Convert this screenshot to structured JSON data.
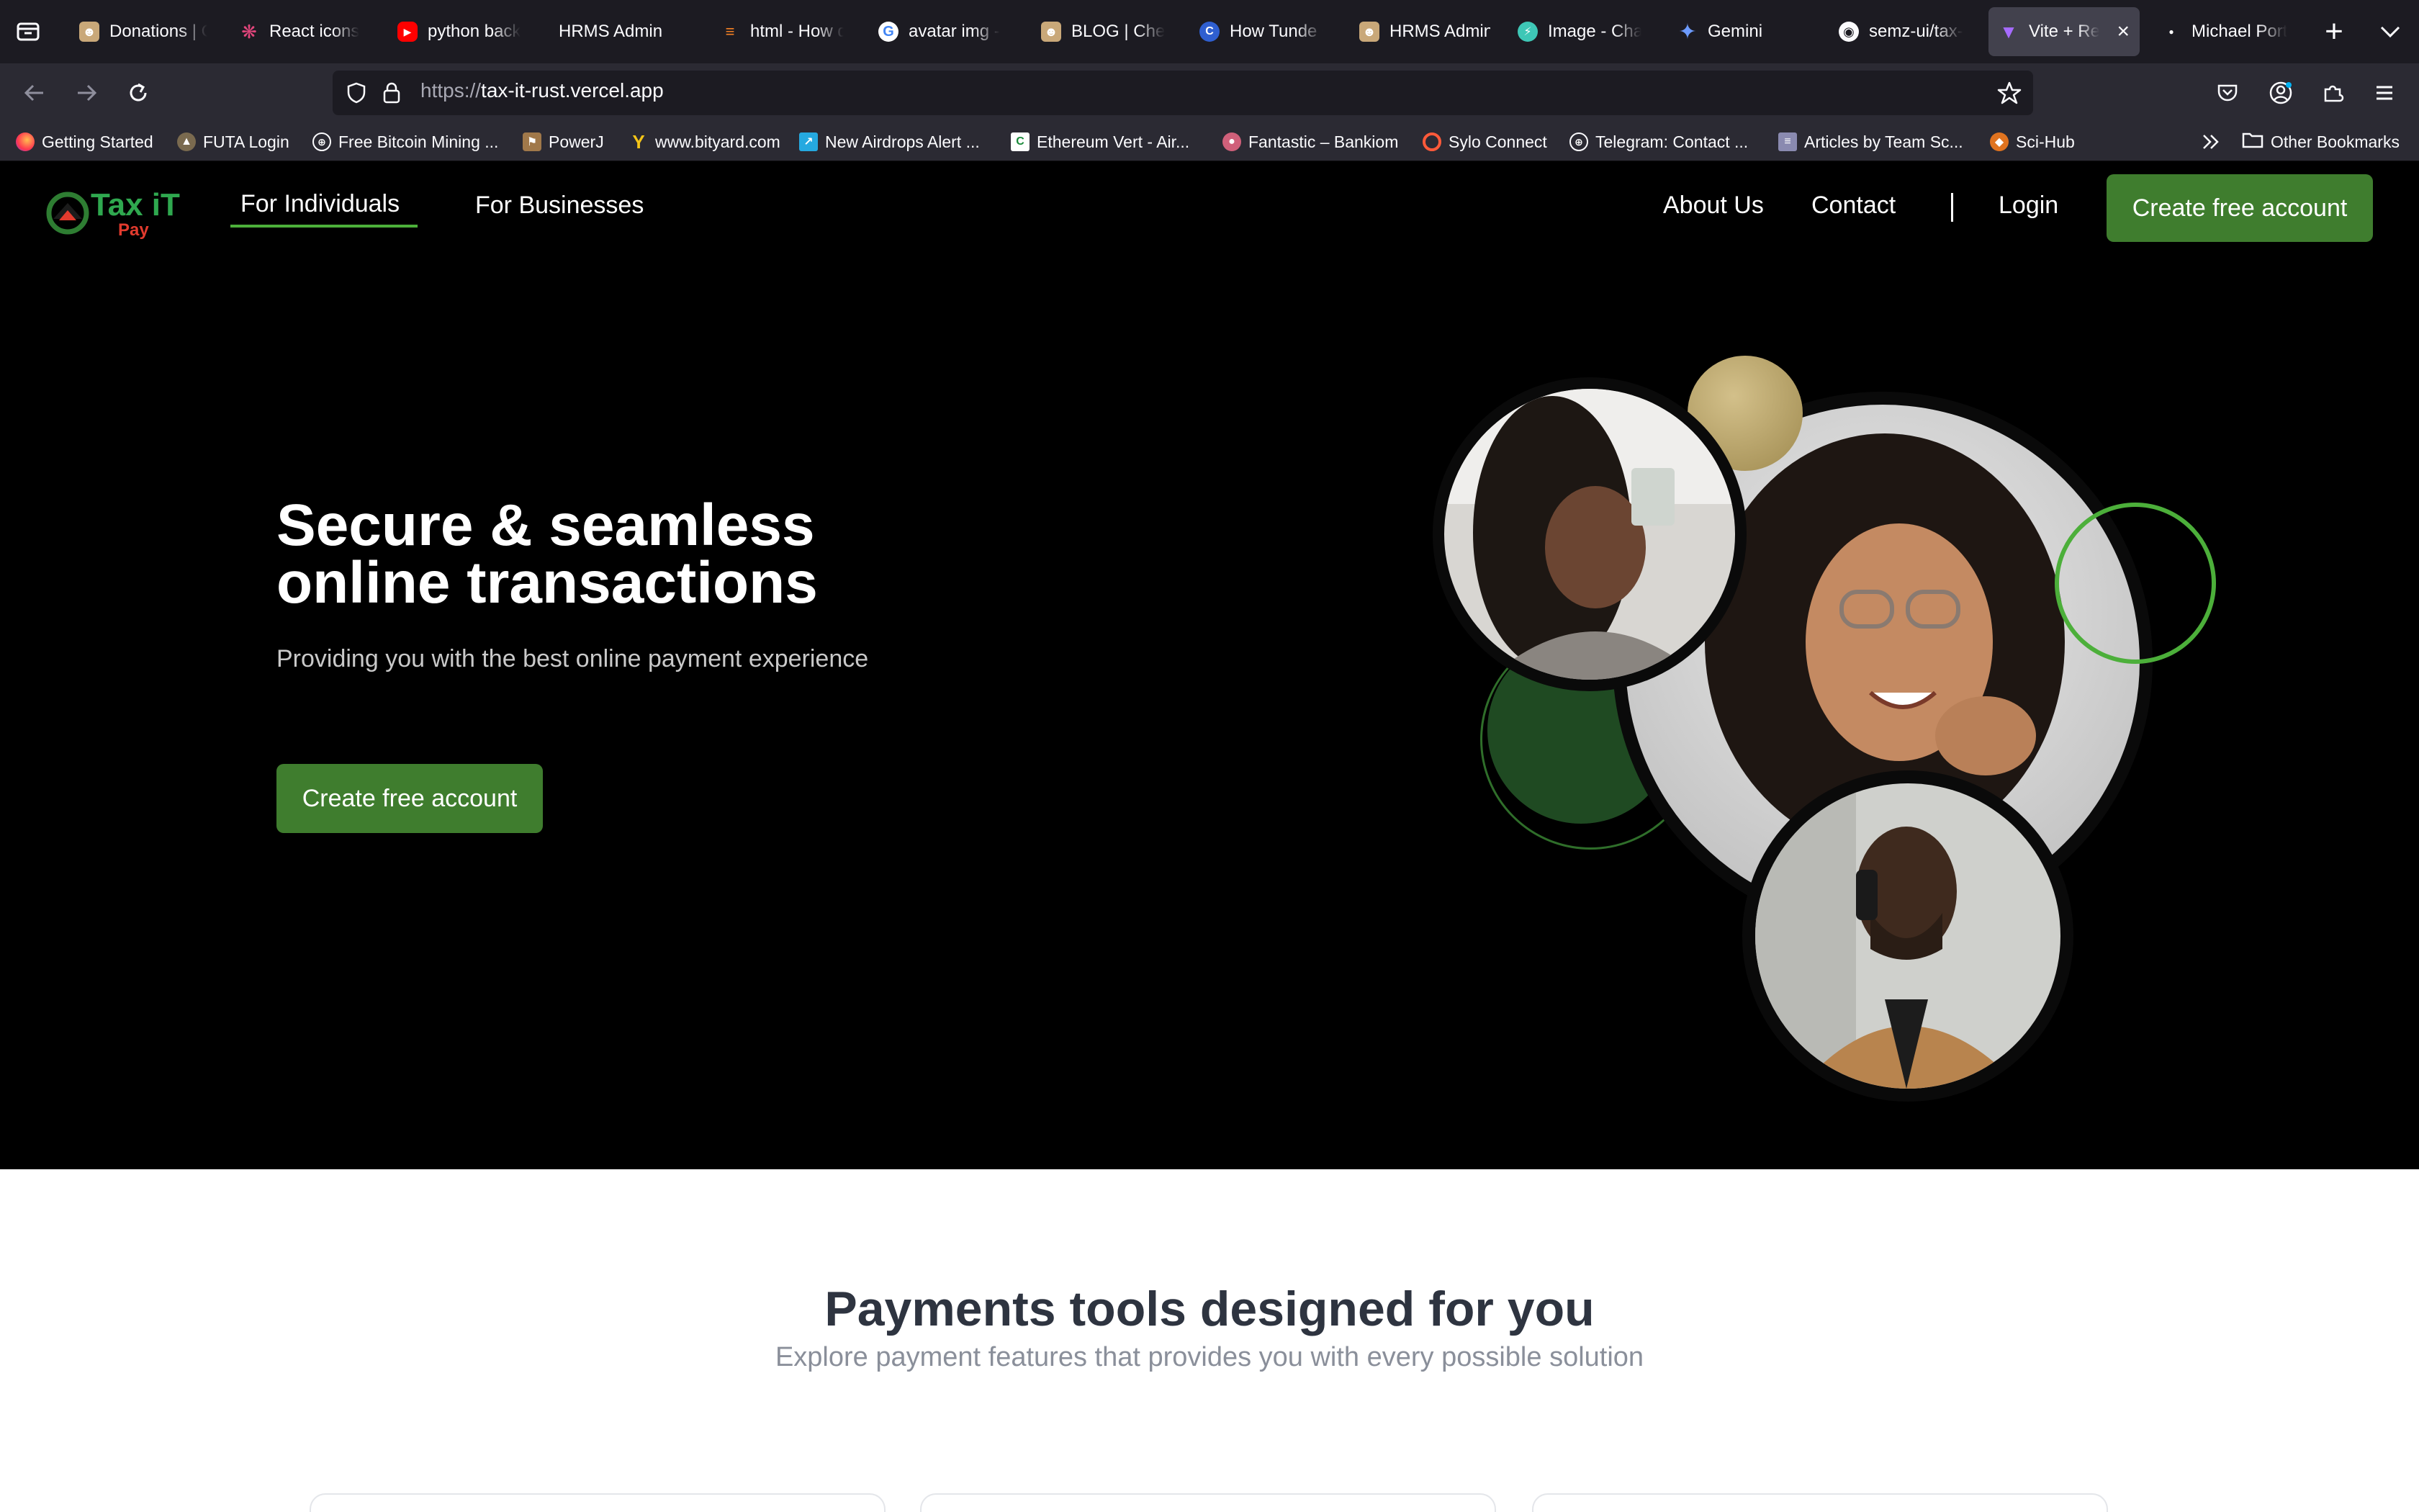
{
  "browser": {
    "tabs": [
      {
        "title": "Donations | C",
        "icon": "portrait-icon"
      },
      {
        "title": "React icons",
        "icon": "react-icon"
      },
      {
        "title": "python back",
        "icon": "youtube-icon"
      },
      {
        "title": "HRMS Admin",
        "icon": ""
      },
      {
        "title": "html - How d",
        "icon": "stackoverflow-icon"
      },
      {
        "title": "avatar img -",
        "icon": "google-icon"
      },
      {
        "title": "BLOG | Ches",
        "icon": "portrait-icon"
      },
      {
        "title": "How Tunde C",
        "icon": "blue-logo-icon"
      },
      {
        "title": "HRMS Admin",
        "icon": "portrait-icon"
      },
      {
        "title": "Image - Cha",
        "icon": "chat-bolt-icon"
      },
      {
        "title": "Gemini",
        "icon": "gemini-icon"
      },
      {
        "title": "semz-ui/tax-",
        "icon": "github-icon"
      },
      {
        "title": "Vite + Rea",
        "icon": "vite-icon"
      },
      {
        "title": "Michael Port",
        "icon": "dot-icon"
      }
    ],
    "url": {
      "scheme": "https://",
      "host": "tax-it-rust.vercel.app"
    },
    "bookmarks": [
      {
        "label": "Getting Started",
        "icon": "firefox-icon"
      },
      {
        "label": "FUTA Login",
        "icon": "crest-icon"
      },
      {
        "label": "Free Bitcoin Mining ...",
        "icon": "globe-icon"
      },
      {
        "label": "PowerJ",
        "icon": "tag-icon"
      },
      {
        "label": "www.bityard.com",
        "icon": "y-icon"
      },
      {
        "label": "New Airdrops Alert ...",
        "icon": "chart-icon"
      },
      {
        "label": "Ethereum Vert - Air...",
        "icon": "c-icon"
      },
      {
        "label": "Fantastic – Bankiom",
        "icon": "pill-icon"
      },
      {
        "label": "Sylo Connect",
        "icon": "ring-icon"
      },
      {
        "label": "Telegram: Contact ...",
        "icon": "globe-icon"
      },
      {
        "label": "Articles by Team Sc...",
        "icon": "stairs-icon"
      },
      {
        "label": "Sci-Hub",
        "icon": "crab-icon"
      }
    ],
    "other_bookmarks": "Other Bookmarks"
  },
  "site": {
    "logo": {
      "main": "Tax iT",
      "sub": "Pay"
    },
    "nav": {
      "individuals": "For Individuals",
      "businesses": "For Businesses",
      "about": "About Us",
      "contact": "Contact",
      "login": "Login",
      "cta": "Create free account"
    },
    "hero": {
      "title_line1": "Secure & seamless",
      "title_line2": "online transactions",
      "subtitle": "Providing you with the best online payment experience",
      "cta": "Create free account"
    },
    "features": {
      "title": "Payments tools designed for you",
      "subtitle": "Explore payment features that provides you with every possible solution"
    }
  },
  "colors": {
    "brand_green": "#3f7d2e",
    "accent_green": "#4caf3a",
    "dark_green": "#1f4a22",
    "gold": "#b9a468",
    "hero_bg": "#000000"
  }
}
